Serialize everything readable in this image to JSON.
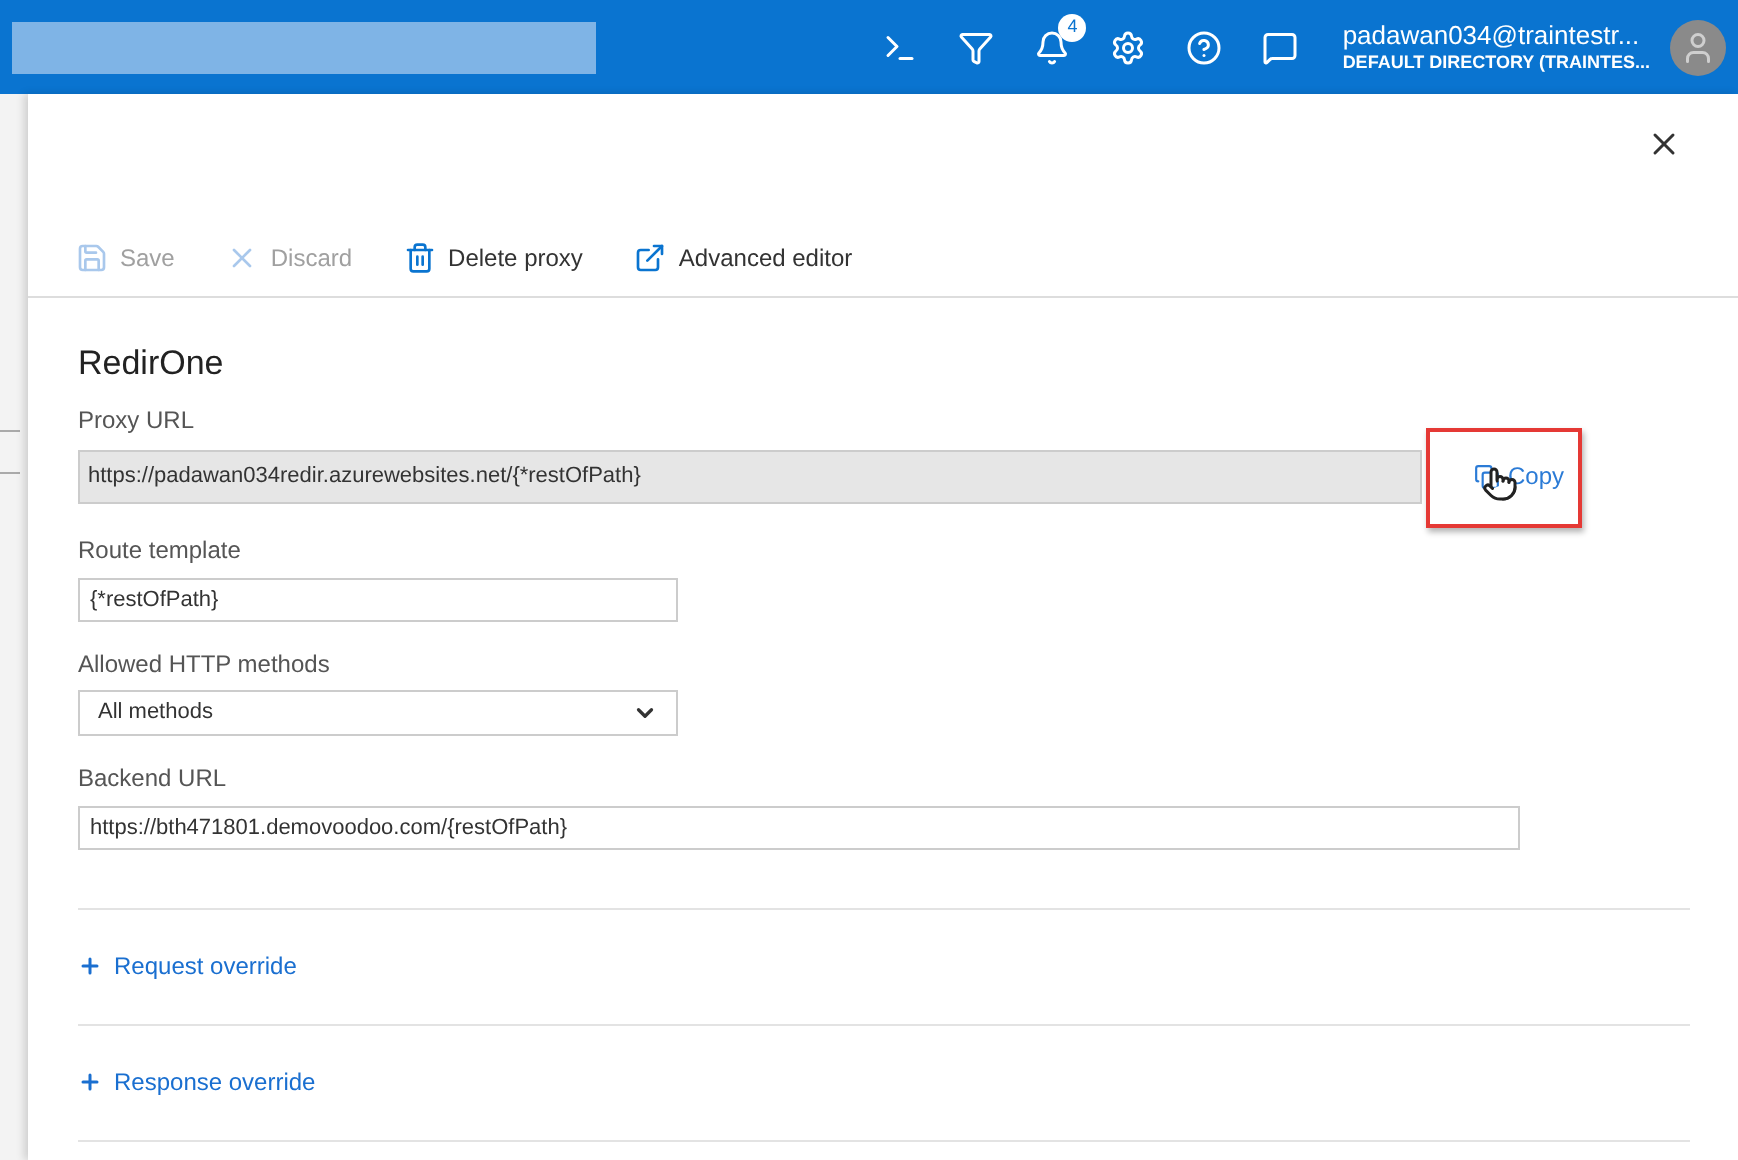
{
  "topbar": {
    "user": "padawan034@traintestr...",
    "directory": "DEFAULT DIRECTORY (TRAINTES...",
    "notification_count": "4"
  },
  "toolbar": [
    {
      "kind": "save",
      "label": "Save",
      "disabled": true
    },
    {
      "kind": "discard",
      "label": "Discard",
      "disabled": true
    },
    {
      "kind": "delete",
      "label": "Delete proxy",
      "disabled": false
    },
    {
      "kind": "editor",
      "label": "Advanced editor",
      "disabled": false
    }
  ],
  "title": "RedirOne",
  "proxy_url": {
    "label": "Proxy URL",
    "value": "https://padawan034redir.azurewebsites.net/{*restOfPath}",
    "copy": "Copy"
  },
  "route_template": {
    "label": "Route template",
    "value": "{*restOfPath}"
  },
  "allowed_methods": {
    "label": "Allowed HTTP methods",
    "value": "All methods"
  },
  "backend_url": {
    "label": "Backend URL",
    "value": "https://bth471801.demovoodoo.com/{restOfPath}"
  },
  "sections": [
    {
      "label": "Request override"
    },
    {
      "label": "Response override"
    }
  ]
}
